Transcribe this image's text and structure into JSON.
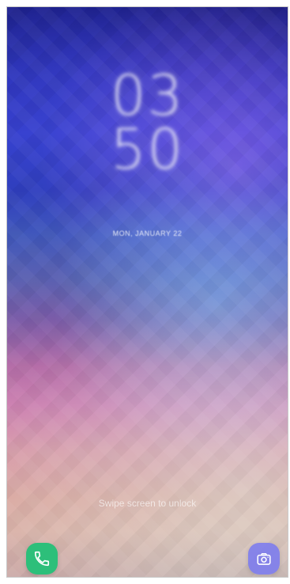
{
  "lockscreen": {
    "clock": {
      "hour": "03",
      "minute": "50"
    },
    "date": "MON, JANUARY 22",
    "unlock_hint": "Swipe screen to unlock"
  },
  "shortcuts": {
    "left_icon": "phone-icon",
    "right_icon": "camera-icon"
  },
  "colors": {
    "phone_accent": "#2dbf7a",
    "camera_accent": "#7878f0"
  }
}
